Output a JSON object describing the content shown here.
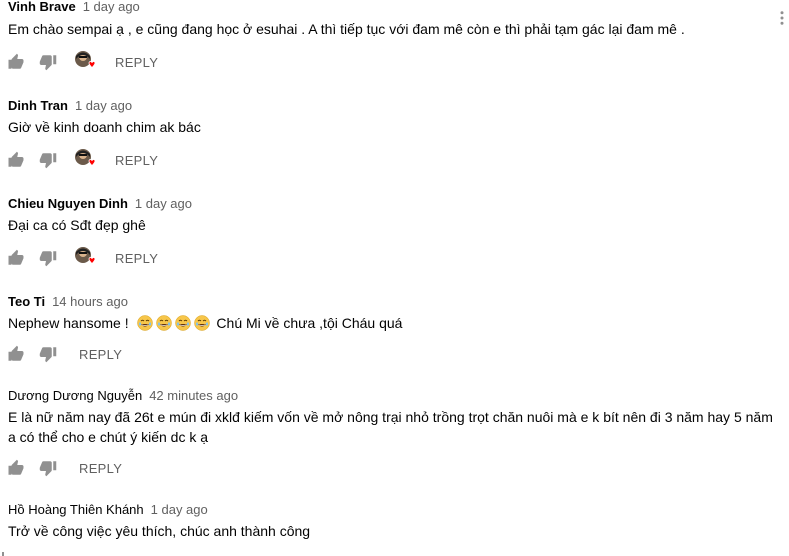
{
  "reply_label": "REPLY",
  "colors": {
    "author": "#030303",
    "meta": "#606060",
    "heart": "#ff0000",
    "icon": "#909090"
  },
  "comments": [
    {
      "author": "Vinh Brave",
      "time": "1 day ago",
      "text": "Em chào sempai ạ , e cũng đang học ở esuhai . A thì tiếp tục với đam mê còn e thì phải tạm gác lại đam mê .",
      "creator_heart": true
    },
    {
      "author": "Dinh Tran",
      "time": "1 day ago",
      "text": "Giờ về kinh doanh chim ak bác",
      "creator_heart": true
    },
    {
      "author": "Chieu Nguyen Dinh",
      "time": "1 day ago",
      "text": "Đại ca có Sđt đẹp ghê",
      "creator_heart": true
    },
    {
      "author": "Teo Ti",
      "time": "14 hours ago",
      "text_before": "Nephew hansome !",
      "emoji_count": 4,
      "emoji_icon": "grinning-sweat-emoji",
      "text_after": "Chú Mi về chưa ,tội Cháu  quá",
      "creator_heart": false
    },
    {
      "author": "Dương Dương Nguyễn",
      "time": "42 minutes ago",
      "text_line1": "E là nữ năm nay đã 26t e mún đi xklđ kiếm vốn về mở nông trại nhỏ trồng trọt chăn nuôi mà e k bít nên đi 3 năm hay 5 năm",
      "text_line2": "a có thể cho e chút ý kiến dc k ạ",
      "creator_heart": false
    },
    {
      "author": "Hồ Hoàng Thiên Khánh",
      "time": "1 day ago",
      "text": "Trở về công việc yêu thích, chúc anh thành công",
      "creator_heart": false
    }
  ]
}
